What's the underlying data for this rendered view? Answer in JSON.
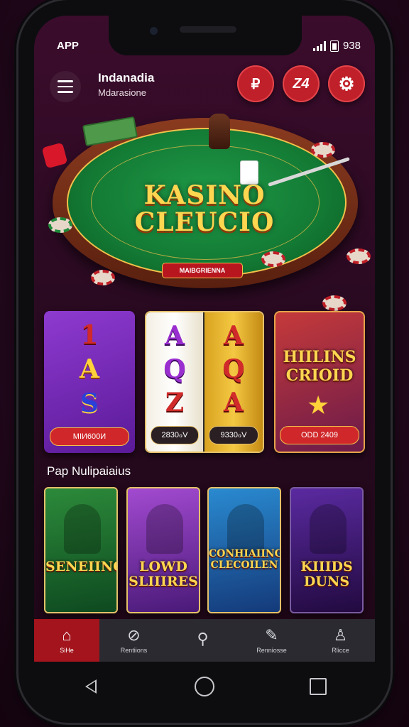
{
  "status_bar": {
    "app_label": "APP",
    "time": "938"
  },
  "header": {
    "brand_title": "Indanadia",
    "brand_subtitle": "Mdarasione",
    "btn1_label": "₽",
    "btn2_label": "Z4",
    "btn3_label": "⚙"
  },
  "hero": {
    "title_line1": "KASINO",
    "title_line2": "CLEUCIO",
    "badge": "MAIBGRIENNA"
  },
  "game_cards": [
    {
      "symbols": [
        "1",
        "A",
        "S"
      ],
      "button": "MIИ600И"
    },
    {
      "reel1": [
        "A",
        "Q",
        "Z"
      ],
      "reel2": [
        "A",
        "Q",
        "A"
      ],
      "button1": "2830ℴV",
      "button2": "9330ℴV"
    },
    {
      "title_line1": "HIILINS",
      "title_line2": "CRIOID",
      "button": "ODD 2409"
    }
  ],
  "section_title": "Pap Nulipaiaius",
  "tiles": [
    {
      "title": "SENEIING"
    },
    {
      "title_line1": "LOWD",
      "title_line2": "SLIIIRES"
    },
    {
      "title_line1": "CONHIAIING",
      "title_line2": "CLECOILEN"
    },
    {
      "title_line1": "KIIIDS",
      "title_line2": "DUNS"
    }
  ],
  "tab_bar": [
    {
      "label": "SiHe",
      "icon": "home-icon"
    },
    {
      "label": "Rentiions",
      "icon": "promo-icon"
    },
    {
      "label": "",
      "icon": "search-icon"
    },
    {
      "label": "Renniosse",
      "icon": "edit-icon"
    },
    {
      "label": "Rlicce",
      "icon": "profile-icon"
    }
  ]
}
